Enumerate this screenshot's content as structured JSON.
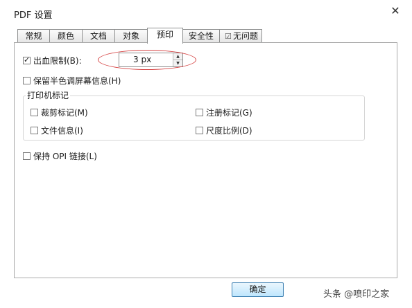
{
  "dialog": {
    "title": "PDF 设置",
    "close_glyph": "✕"
  },
  "tabs": [
    {
      "label": "常规",
      "active": false
    },
    {
      "label": "颜色",
      "active": false
    },
    {
      "label": "文档",
      "active": false
    },
    {
      "label": "对象",
      "active": false
    },
    {
      "label": "预印",
      "active": true
    },
    {
      "label": "安全性",
      "active": false
    },
    {
      "label": "无问题",
      "active": false,
      "icon": "check-doc-icon"
    }
  ],
  "options": {
    "bleed": {
      "label": "出血限制(B):",
      "checked": true,
      "value": "3 px"
    },
    "halftone": {
      "label": "保留半色调屏幕信息(H)",
      "checked": false
    },
    "printer_marks": {
      "title": "打印机标记",
      "crop": {
        "label": "裁剪标记(M)",
        "checked": false
      },
      "registration": {
        "label": "注册标记(G)",
        "checked": false
      },
      "file_info": {
        "label": "文件信息(I)",
        "checked": false
      },
      "scale": {
        "label": "尺度比例(D)",
        "checked": false
      }
    },
    "opi": {
      "label": "保持 OPI 链接(L)",
      "checked": false
    }
  },
  "footer": {
    "ok_label": "确定",
    "watermark": "头条 @喷印之家"
  },
  "annotation_color": "#d64545"
}
